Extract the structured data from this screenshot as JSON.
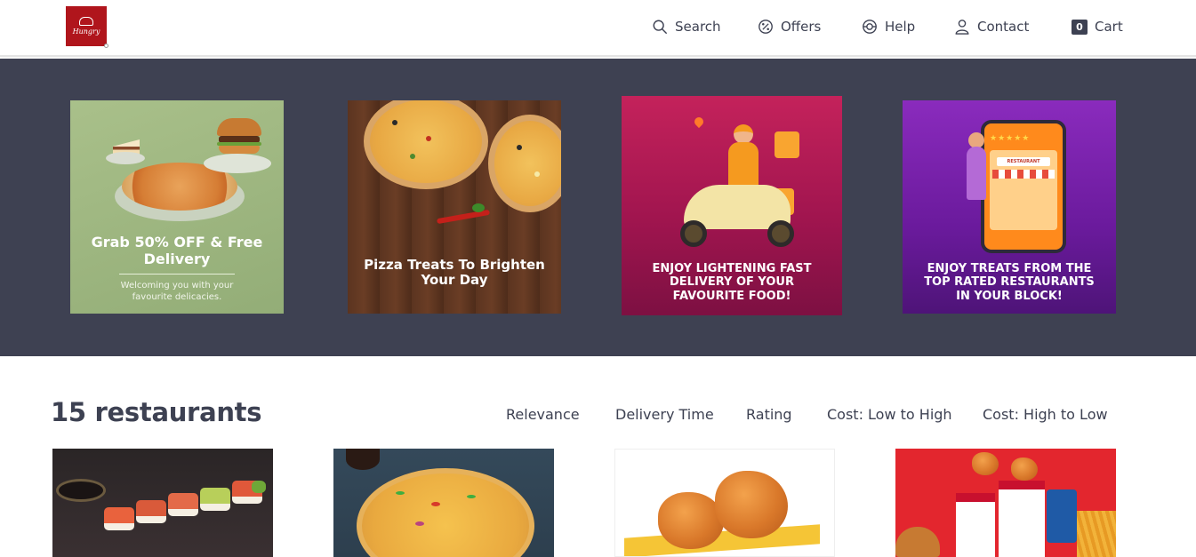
{
  "header": {
    "logo_text": "Hungry",
    "nav": {
      "search": "Search",
      "offers": "Offers",
      "help": "Help",
      "contact": "Contact",
      "cart": "Cart",
      "cart_count": "0"
    }
  },
  "banner": {
    "offers": [
      {
        "title": "Grab 50% OFF & Free Delivery",
        "subtitle": "Welcoming you with your favourite delicacies."
      },
      {
        "title": "Pizza Treats To Brighten Your Day"
      },
      {
        "title": "ENJOY LIGHTENING FAST DELIVERY OF YOUR FAVOURITE FOOD!"
      },
      {
        "title": "ENJOY TREATS FROM THE TOP RATED RESTAURANTS IN YOUR BLOCK!",
        "sign": "RESTAURANT"
      }
    ]
  },
  "restaurants": {
    "count_label": "15 restaurants",
    "sort_options": [
      "Relevance",
      "Delivery Time",
      "Rating",
      "Cost: Low to High",
      "Cost: High to Low"
    ]
  },
  "colors": {
    "banner_bg": "#3e4152",
    "text": "#3d4152",
    "brand_red": "#b0151c"
  }
}
